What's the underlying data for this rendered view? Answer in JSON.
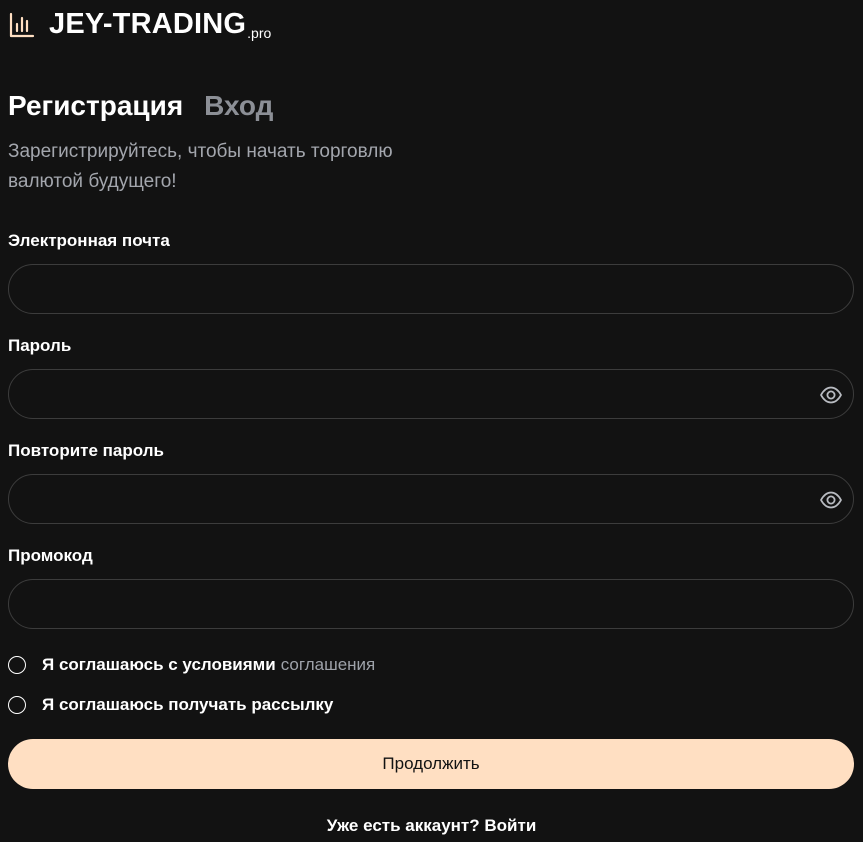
{
  "brand": {
    "name": "JEY-TRADING",
    "suffix": ".pro",
    "icon": "bar-chart-icon",
    "accent": "#ffdfc2"
  },
  "tabs": [
    {
      "label": "Регистрация",
      "active": true
    },
    {
      "label": "Вход",
      "active": false
    }
  ],
  "subtitle": "Зарегистрируйтесь, чтобы начать торговлю валютой будущего!",
  "fields": {
    "email": {
      "label": "Электронная почта",
      "value": "",
      "placeholder": ""
    },
    "password": {
      "label": "Пароль",
      "value": "",
      "placeholder": "",
      "icon": "eye-icon"
    },
    "password_repeat": {
      "label": "Повторите пароль",
      "value": "",
      "placeholder": "",
      "icon": "eye-icon"
    },
    "promo": {
      "label": "Промокод",
      "value": "",
      "placeholder": ""
    }
  },
  "checkboxes": {
    "terms": {
      "text": "Я соглашаюсь с условиями",
      "link": "соглашения",
      "checked": false
    },
    "newsletter": {
      "text": "Я соглашаюсь получать рассылку",
      "checked": false
    }
  },
  "submit_label": "Продолжить",
  "footer": {
    "text": "Уже есть аккаунт?",
    "link": "Войти"
  }
}
